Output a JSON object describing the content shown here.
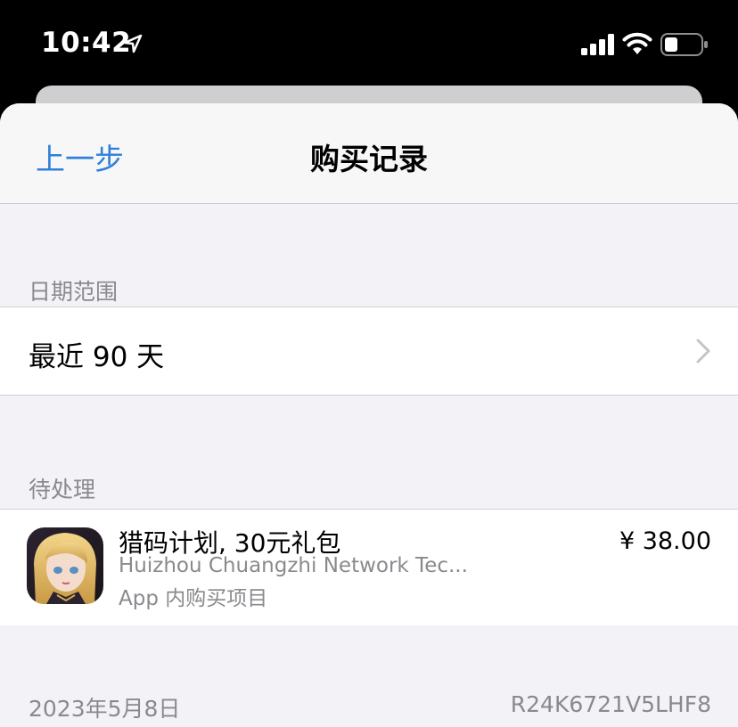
{
  "status_bar": {
    "time": "10:42",
    "icons": [
      "location-arrow-icon",
      "signal-icon",
      "wifi-icon",
      "battery-icon"
    ]
  },
  "nav": {
    "back_label": "上一步",
    "title": "购买记录"
  },
  "date_range": {
    "header": "日期范围",
    "value": "最近 90 天"
  },
  "pending": {
    "header": "待处理",
    "item": {
      "title": "猎码计划, 30元礼包",
      "developer": "Huizhou Chuangzhi Network Tec...",
      "type": "App 内购买项目",
      "price": "¥ 38.00",
      "icon": "app-icon"
    }
  },
  "next_group": {
    "date": "2023年5月8日",
    "order_id": "R24K6721V5LHF8"
  },
  "colors": {
    "accent": "#2f7fdb",
    "background": "#f2f2f7",
    "secondary_text": "#8a8a8e"
  }
}
